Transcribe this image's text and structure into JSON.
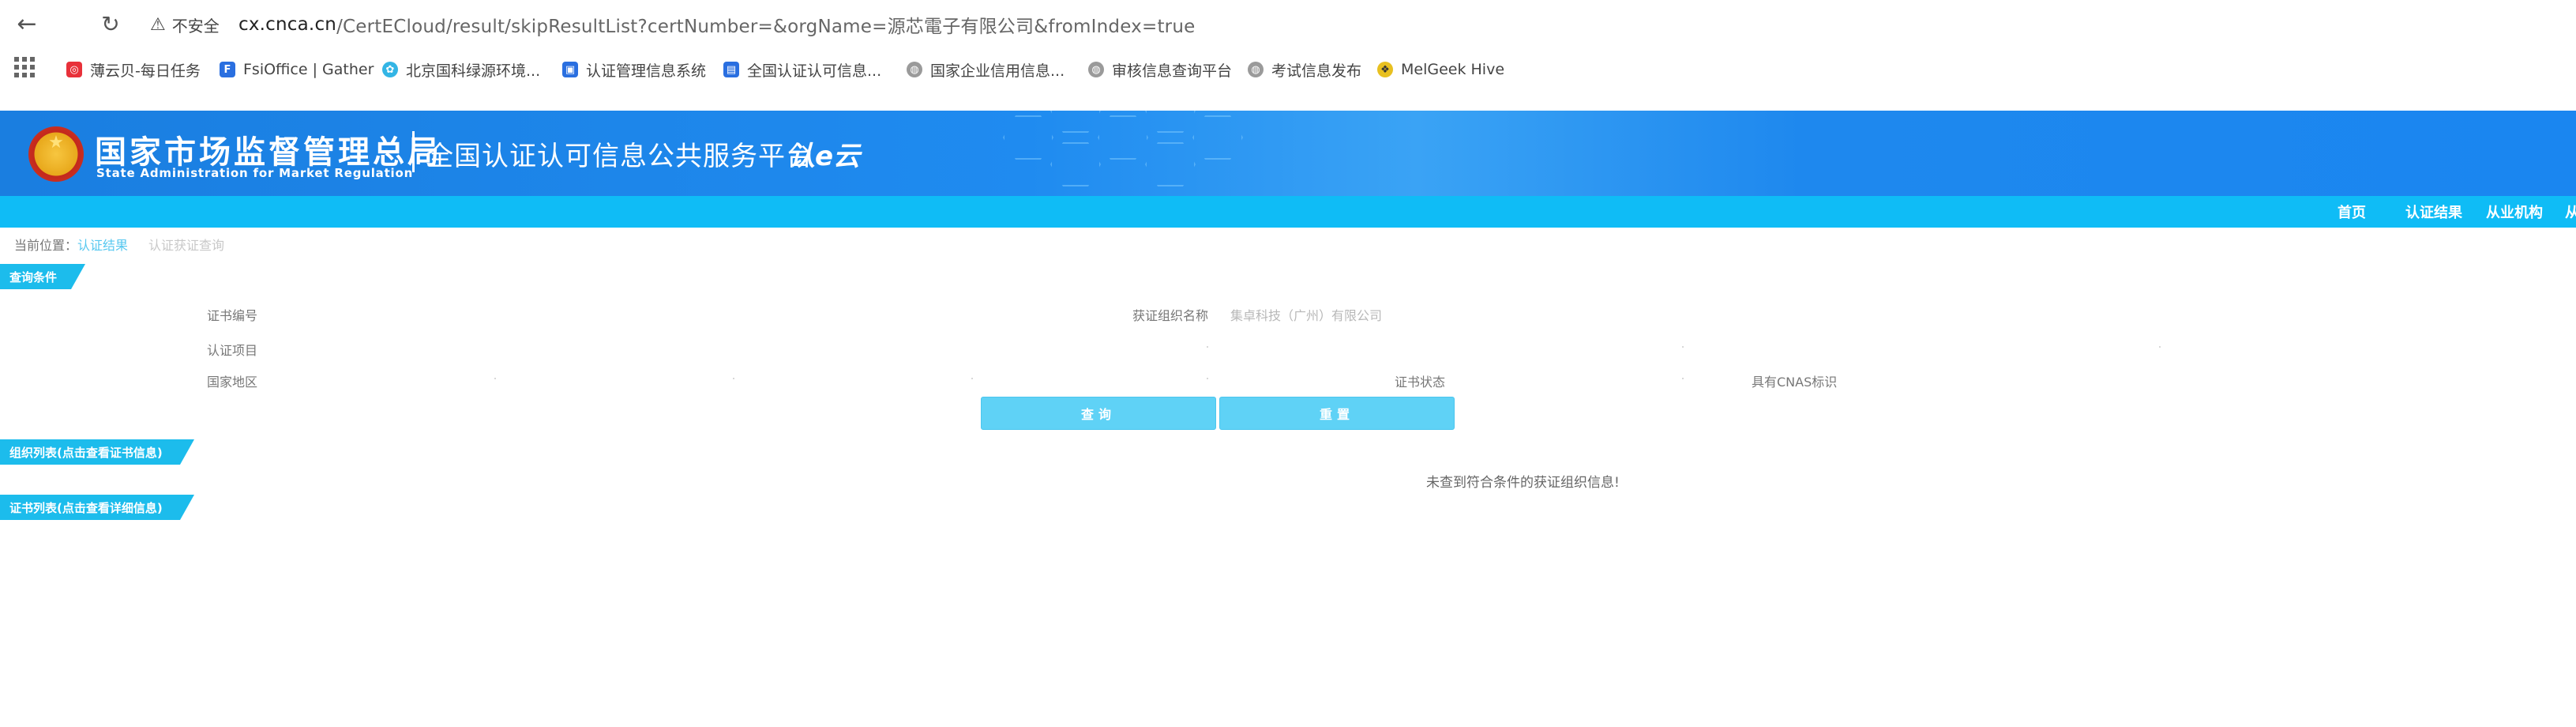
{
  "browser": {
    "insecure_label": "不安全",
    "url_host": "cx.cnca.cn",
    "url_path": "/CertECloud/result/skipResultList?certNumber=&orgName=源芯電子有限公司&fromIndex=true",
    "bookmarks": [
      {
        "label": "薄云贝-每日任务",
        "icon": "netease-icon",
        "color": "#e8313a"
      },
      {
        "label": "FsiOffice | Gather",
        "icon": "fsioffice-icon",
        "color": "#2a6fe0"
      },
      {
        "label": "北京国科绿源环境...",
        "icon": "leaf-icon",
        "color": "#33b5e5"
      },
      {
        "label": "认证管理信息系统",
        "icon": "doc-icon",
        "color": "#2a6fe0"
      },
      {
        "label": "全国认证认可信息...",
        "icon": "cert-icon",
        "color": "#2a6fe0"
      },
      {
        "label": "国家企业信用信息...",
        "icon": "globe-icon",
        "color": "#9a9a9a"
      },
      {
        "label": "审核信息查询平台",
        "icon": "globe-icon",
        "color": "#9a9a9a"
      },
      {
        "label": "考试信息发布",
        "icon": "globe-icon",
        "color": "#9a9a9a"
      },
      {
        "label": "MelGeek Hive",
        "icon": "melgeek-icon",
        "color": "#e8c020"
      }
    ]
  },
  "header": {
    "gov_name": "国家市场监督管理总局",
    "gov_name_en": "State Administration  for  Market Regulation",
    "platform_name": "全国认证认可信息公共服务平台",
    "logo_text": "认e云"
  },
  "nav": {
    "items": [
      "首页",
      "认证结果",
      "从业机构",
      "从"
    ]
  },
  "breadcrumb": {
    "prefix": "当前位置：",
    "link": "认证结果",
    "current": "认证获证查询"
  },
  "query": {
    "section_title": "查询条件",
    "cert_number_label": "证书编号",
    "org_name_label": "获证组织名称",
    "org_name_value": "集卓科技（广州）有限公司",
    "cert_project_label": "认证项目",
    "region_label": "国家地区",
    "cert_status_label": "证书状态",
    "cnas_label": "具有CNAS标识",
    "search_button": "查询",
    "reset_button": "重置"
  },
  "org_list": {
    "section_title": "组织列表(点击查看证书信息)",
    "empty_message": "未查到符合条件的获证组织信息!"
  },
  "cert_list": {
    "section_title": "证书列表(点击查看详细信息)"
  },
  "colors": {
    "banner_blue": "#1a86f0",
    "nav_cyan": "#0fbcf6",
    "section_tab": "#1cbcec",
    "button": "#5fd2f6"
  }
}
